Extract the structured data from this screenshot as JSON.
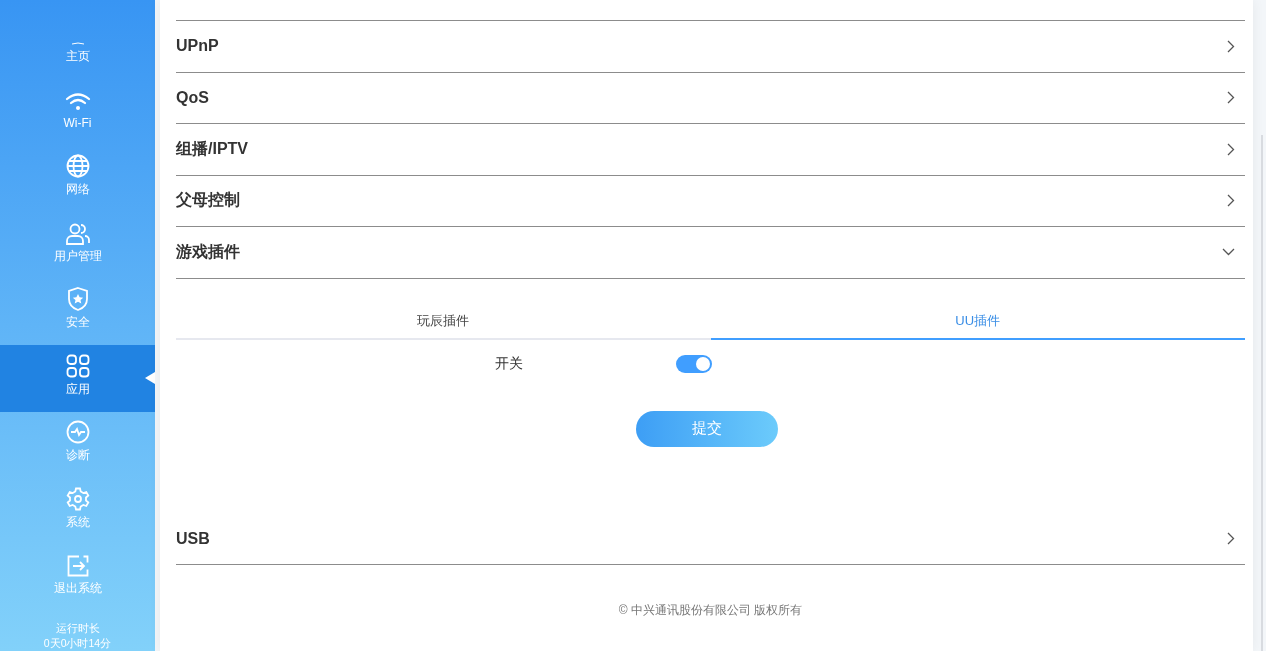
{
  "sidebar": {
    "items": [
      {
        "label": "主页",
        "selected": false
      },
      {
        "label": "Wi-Fi",
        "selected": false
      },
      {
        "label": "网络",
        "selected": false
      },
      {
        "label": "用户管理",
        "selected": false
      },
      {
        "label": "安全",
        "selected": false
      },
      {
        "label": "应用",
        "selected": true
      },
      {
        "label": "诊断",
        "selected": false
      },
      {
        "label": "系统",
        "selected": false
      },
      {
        "label": "退出系统",
        "selected": false
      }
    ],
    "uptime_label": "运行时长",
    "uptime_value": "0天0小时14分"
  },
  "settings": [
    {
      "label": "UPnP",
      "expanded": false
    },
    {
      "label": "QoS",
      "expanded": false
    },
    {
      "label": "组播/IPTV",
      "expanded": false
    },
    {
      "label": "父母控制",
      "expanded": false
    },
    {
      "label": "游戏插件",
      "expanded": true
    },
    {
      "label": "USB",
      "expanded": false
    }
  ],
  "game_plugin": {
    "tabs": [
      {
        "label": "玩辰插件",
        "selected": false
      },
      {
        "label": "UU插件",
        "selected": true
      }
    ],
    "switch": {
      "label": "开关",
      "on": true
    },
    "submit_button": "提交"
  },
  "footer": "© 中兴通讯股份有限公司 版权所有"
}
